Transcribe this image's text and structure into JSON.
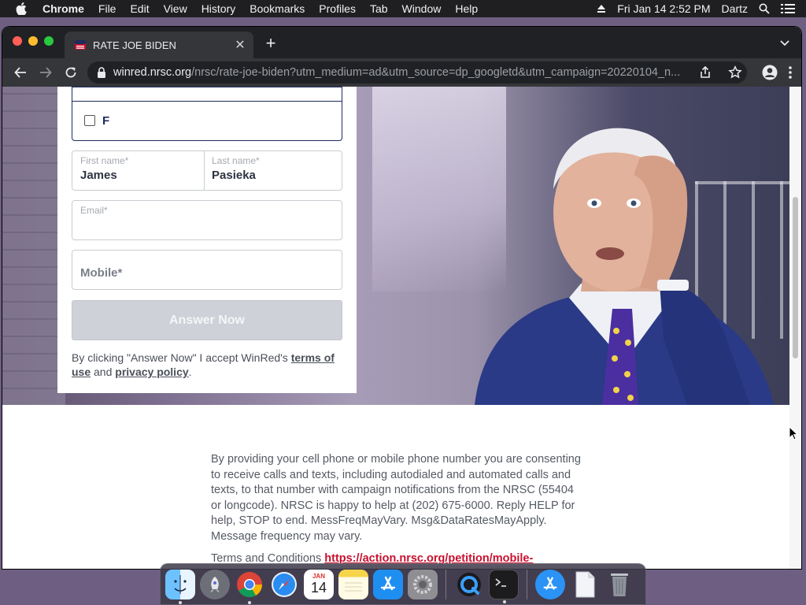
{
  "menubar": {
    "app_name": "Chrome",
    "items": [
      "File",
      "Edit",
      "View",
      "History",
      "Bookmarks",
      "Profiles",
      "Tab",
      "Window",
      "Help"
    ],
    "clock": "Fri Jan 14  2:52 PM",
    "user": "Dartz"
  },
  "browser": {
    "tab_title": "RATE JOE BIDEN",
    "url_domain": "winred.nrsc.org",
    "url_path": "/nrsc/rate-joe-biden?utm_medium=ad&utm_source=dp_googletd&utm_campaign=20220104_n..."
  },
  "form": {
    "option_label": "F",
    "first_name_label": "First name*",
    "first_name_value": "James",
    "last_name_label": "Last name*",
    "last_name_value": "Pasieka",
    "email_label": "Email*",
    "mobile_placeholder": "Mobile*",
    "submit_label": "Answer Now",
    "consent_prefix": "By clicking \"Answer Now\" I accept WinRed's",
    "terms_link": "terms of use",
    "consent_and": "and",
    "privacy_link": "privacy policy",
    "consent_end": "."
  },
  "disclaimer": {
    "text": "By providing your cell phone or mobile phone number you are consenting to receive calls and texts, including autodialed and automated calls and texts, to that number with campaign notifications from the NRSC (55404 or longcode). NRSC is happy to help at (202) 675-6000. Reply HELP for help, STOP to end. MessFreqMayVary. Msg&DataRatesMayApply. Message frequency may vary.",
    "terms_prefix": "Terms and Conditions",
    "terms_link": "https://action.nrsc.org/petition/mobile-"
  },
  "dock": {
    "items": [
      "finder-icon",
      "launchpad-icon",
      "chrome-icon",
      "safari-icon",
      "calendar-icon",
      "notes-icon",
      "app-store-icon",
      "system-preferences-icon",
      "quicktime-icon",
      "terminal-icon",
      "app-store-folder-icon",
      "documents-folder-icon",
      "trash-icon"
    ],
    "calendar_month": "JAN",
    "calendar_day": "14"
  },
  "colors": {
    "accent_navy": "#1e2b5c",
    "link_red": "#c8102e",
    "button_disabled": "#cfd1d8"
  }
}
